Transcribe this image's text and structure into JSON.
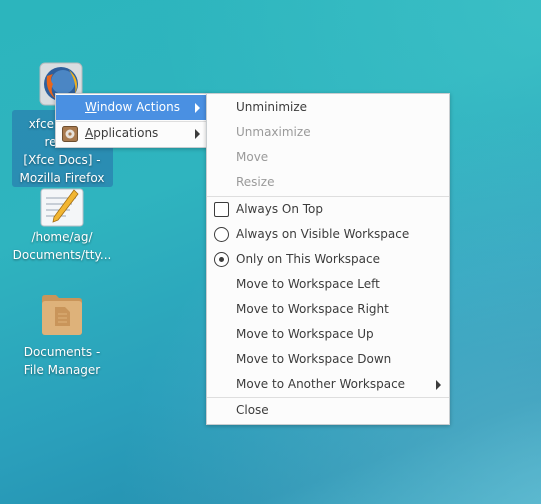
{
  "desktop": {
    "icons": [
      {
        "label_lines": [
          "xfce:xfce4-",
          "refe...",
          "[Xfce Docs] -",
          "Mozilla Firefox"
        ],
        "icon": "firefox-icon",
        "selected": true
      },
      {
        "label_lines": [
          "/home/ag/",
          "Documents/tty..."
        ],
        "icon": "text-editor-icon",
        "selected": false
      },
      {
        "label_lines": [
          "Documents -",
          "File Manager"
        ],
        "icon": "folder-icon",
        "selected": false
      }
    ]
  },
  "context_menu": {
    "items": [
      {
        "label": "Window Actions",
        "mnemonic": "W",
        "rest": "indow Actions",
        "submenu": true,
        "highlighted": true
      },
      {
        "label": "Applications",
        "mnemonic": "A",
        "rest": "pplications",
        "submenu": true,
        "icon": "applications-icon"
      }
    ]
  },
  "window_actions_menu": {
    "items": [
      {
        "label": "Unminimize",
        "enabled": true
      },
      {
        "label": "Unmaximize",
        "enabled": false
      },
      {
        "label": "Move",
        "enabled": false
      },
      {
        "label": "Resize",
        "enabled": false
      },
      {
        "label": "Always On Top",
        "type": "checkbox",
        "checked": false
      },
      {
        "label": "Always on Visible Workspace",
        "type": "radio",
        "checked": false
      },
      {
        "label": "Only on This Workspace",
        "type": "radio",
        "checked": true
      },
      {
        "label": "Move to Workspace Left"
      },
      {
        "label": "Move to Workspace Right"
      },
      {
        "label": "Move to Workspace Up"
      },
      {
        "label": "Move to Workspace Down"
      },
      {
        "label": "Move to Another Workspace",
        "submenu": true
      },
      {
        "label": "Close"
      }
    ]
  },
  "colors": {
    "highlight": "#4a90e2",
    "menu_bg": "#fcfcfc",
    "text": "#3c3c3c",
    "disabled_text": "#9a9a9a"
  }
}
